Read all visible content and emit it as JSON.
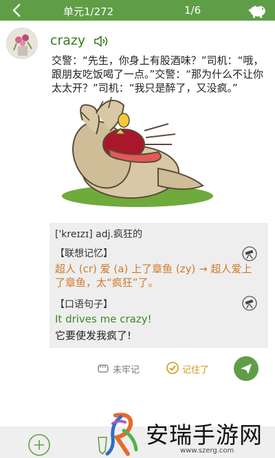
{
  "header": {
    "unit_label": "单元1/272",
    "page_label": "1/6"
  },
  "word": {
    "text": "crazy",
    "dialog": "交警：“先生，你身上有股酒味？”司机：“哦，跟朋友吃饭喝了一点。”交警：“那为什么不让你太太开？”司机：“我只是醉了，又没疯。”"
  },
  "definition": {
    "phonetic_pos": "['kreɪzɪ] adj.疯狂的",
    "memory_label": "【联想记忆】",
    "memory_text": "超人 (cr) 爱 (a) 上了章鱼 (zy) → 超人爱上了章鱼，太“疯狂”了。",
    "oral_label": "【口语句子】",
    "oral_en": "It drives me crazy!",
    "oral_cn": "它要使发我疯了!"
  },
  "actions": {
    "unremembered": "未牢记",
    "remembered": "记住了"
  },
  "watermark": {
    "brand": "安瑞手游网",
    "url": "www.szerg.com"
  },
  "colors": {
    "brand_green": "#5f9e46",
    "word_green": "#3a7a1e",
    "memory_orange": "#d17a2a",
    "remembered_gold": "#cc9a16"
  }
}
